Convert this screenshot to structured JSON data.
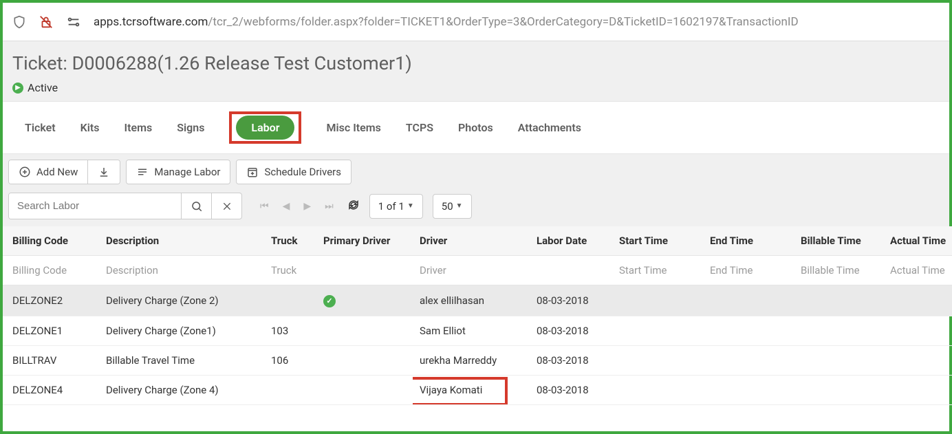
{
  "url": {
    "domain": "apps.tcrsoftware.com",
    "path": "/tcr_2/webforms/folder.aspx?folder=TICKET1&OrderType=3&OrderCategory=D&TicketID=1602197&TransactionID"
  },
  "page_title": "Ticket: D0006288(1.26 Release Test Customer1)",
  "status": "Active",
  "tabs": [
    "Ticket",
    "Kits",
    "Items",
    "Signs",
    "Labor",
    "Misc Items",
    "TCPS",
    "Photos",
    "Attachments"
  ],
  "active_tab": "Labor",
  "toolbar": {
    "add_new": "Add New",
    "manage_labor": "Manage Labor",
    "schedule_drivers": "Schedule Drivers"
  },
  "search": {
    "placeholder": "Search Labor"
  },
  "pager": {
    "page_of": "1 of 1",
    "page_size": "50"
  },
  "columns": {
    "billing_code": "Billing Code",
    "description": "Description",
    "truck": "Truck",
    "primary_driver": "Primary Driver",
    "driver": "Driver",
    "labor_date": "Labor Date",
    "start_time": "Start Time",
    "end_time": "End Time",
    "billable_time": "Billable Time",
    "actual_time": "Actual Time"
  },
  "filters": {
    "billing_code": "Billing Code",
    "description": "Description",
    "truck": "Truck",
    "driver": "Driver",
    "start_time": "Start Time",
    "end_time": "End Time",
    "billable_time": "Billable Time",
    "actual_time": "Actual Time"
  },
  "rows": [
    {
      "billing_code": "DELZONE2",
      "description": "Delivery Charge (Zone 2)",
      "truck": "",
      "primary": true,
      "driver": "alex ellilhasan",
      "labor_date": "08-03-2018"
    },
    {
      "billing_code": "DELZONE1",
      "description": "Delivery Charge (Zone1)",
      "truck": "103",
      "primary": false,
      "driver": "Sam Elliot",
      "labor_date": "08-03-2018"
    },
    {
      "billing_code": "BILLTRAV",
      "description": "Billable Travel Time",
      "truck": "106",
      "primary": false,
      "driver": "urekha Marreddy",
      "labor_date": "08-03-2018"
    },
    {
      "billing_code": "DELZONE4",
      "description": "Delivery Charge (Zone 4)",
      "truck": "",
      "primary": false,
      "driver": "Vijaya Komati",
      "labor_date": "08-03-2018"
    }
  ]
}
